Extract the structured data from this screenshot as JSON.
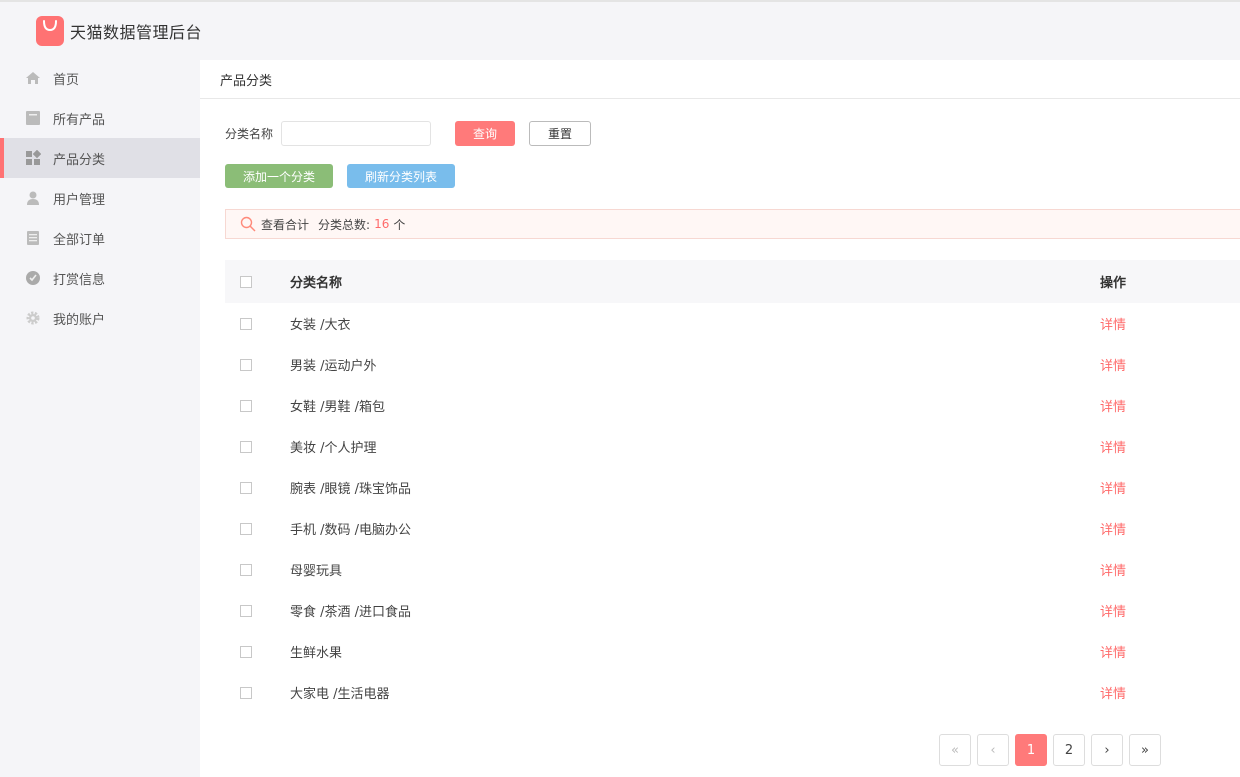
{
  "app": {
    "title": "天猫数据管理后台"
  },
  "colors": {
    "accent": "#ff7273",
    "add_button": "#8bbd77",
    "refresh_button": "#79bdec",
    "link": "#ff6a6a"
  },
  "sidebar": {
    "items": [
      {
        "label": "首页",
        "icon": "home-icon",
        "active": false
      },
      {
        "label": "所有产品",
        "icon": "product-icon",
        "active": false
      },
      {
        "label": "产品分类",
        "icon": "category-grid-icon",
        "active": true
      },
      {
        "label": "用户管理",
        "icon": "user-icon",
        "active": false
      },
      {
        "label": "全部订单",
        "icon": "order-list-icon",
        "active": false
      },
      {
        "label": "打赏信息",
        "icon": "reward-icon",
        "active": false
      },
      {
        "label": "我的账户",
        "icon": "gear-icon",
        "active": false
      }
    ]
  },
  "breadcrumb": {
    "title": "产品分类"
  },
  "filter": {
    "label": "分类名称",
    "value": "",
    "placeholder": "",
    "query_label": "查询",
    "reset_label": "重置"
  },
  "actions": {
    "add_label": "添加一个分类",
    "refresh_label": "刷新分类列表"
  },
  "summary": {
    "view_label": "查看合计",
    "total_label": "分类总数:",
    "total_count": "16",
    "unit": "个"
  },
  "table": {
    "columns": {
      "name": "分类名称",
      "operation": "操作"
    },
    "rows": [
      {
        "name": "女装 /大衣",
        "action": "详情"
      },
      {
        "name": "男装 /运动户外",
        "action": "详情"
      },
      {
        "name": "女鞋 /男鞋 /箱包",
        "action": "详情"
      },
      {
        "name": "美妆 /个人护理",
        "action": "详情"
      },
      {
        "name": "腕表 /眼镜 /珠宝饰品",
        "action": "详情"
      },
      {
        "name": "手机 /数码 /电脑办公",
        "action": "详情"
      },
      {
        "name": "母婴玩具",
        "action": "详情"
      },
      {
        "name": "零食 /茶酒 /进口食品",
        "action": "详情"
      },
      {
        "name": "生鲜水果",
        "action": "详情"
      },
      {
        "name": "大家电 /生活电器",
        "action": "详情"
      }
    ]
  },
  "pagination": {
    "first": "«",
    "prev": "‹",
    "pages": [
      "1",
      "2"
    ],
    "current": "1",
    "next": "›",
    "last": "»"
  }
}
